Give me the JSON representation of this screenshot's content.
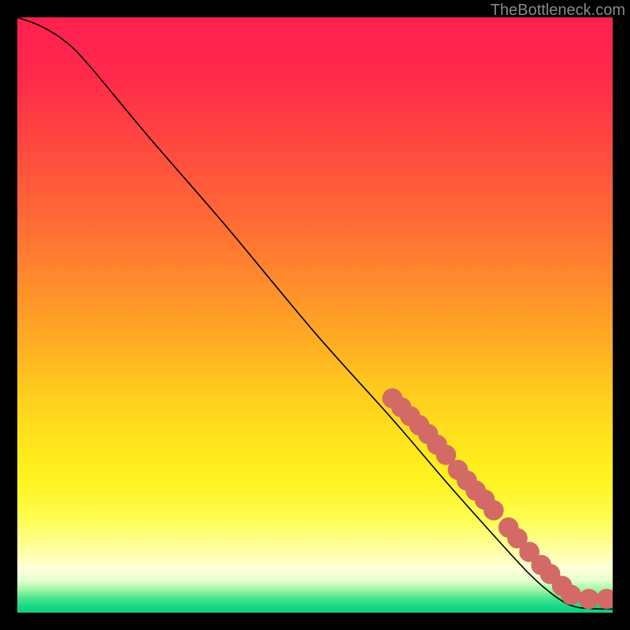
{
  "watermark": "TheBottleneck.com",
  "colors": {
    "marker": "#d36a66",
    "curve": "#000000"
  },
  "chart_data": {
    "type": "line",
    "title": "",
    "xlabel": "",
    "ylabel": "",
    "xlim": [
      0,
      100
    ],
    "ylim": [
      0,
      100
    ],
    "grid": false,
    "legend": false,
    "curve": [
      {
        "x": 0,
        "y": 100
      },
      {
        "x": 4,
        "y": 98.5
      },
      {
        "x": 8,
        "y": 96
      },
      {
        "x": 12,
        "y": 92
      },
      {
        "x": 22,
        "y": 80
      },
      {
        "x": 35,
        "y": 65
      },
      {
        "x": 50,
        "y": 47
      },
      {
        "x": 63,
        "y": 32.5
      },
      {
        "x": 72,
        "y": 22
      },
      {
        "x": 80,
        "y": 13
      },
      {
        "x": 86,
        "y": 6.5
      },
      {
        "x": 90,
        "y": 3
      },
      {
        "x": 93,
        "y": 1.2
      },
      {
        "x": 96,
        "y": 0.7
      },
      {
        "x": 100,
        "y": 0.6
      }
    ],
    "markers": {
      "radius_pct": 1.2,
      "points": [
        {
          "x": 63.0,
          "y": 36.0
        },
        {
          "x": 64.5,
          "y": 34.5
        },
        {
          "x": 66.0,
          "y": 33.0
        },
        {
          "x": 67.5,
          "y": 31.5
        },
        {
          "x": 69.0,
          "y": 30.0
        },
        {
          "x": 70.5,
          "y": 28.2
        },
        {
          "x": 72.0,
          "y": 26.5
        },
        {
          "x": 74.0,
          "y": 24.0
        },
        {
          "x": 75.5,
          "y": 22.2
        },
        {
          "x": 77.0,
          "y": 20.5
        },
        {
          "x": 78.5,
          "y": 19.0
        },
        {
          "x": 80.0,
          "y": 17.2
        },
        {
          "x": 82.5,
          "y": 14.3
        },
        {
          "x": 84.0,
          "y": 12.5
        },
        {
          "x": 86.0,
          "y": 10.2
        },
        {
          "x": 88.0,
          "y": 8.0
        },
        {
          "x": 89.5,
          "y": 6.5
        },
        {
          "x": 91.5,
          "y": 4.5
        },
        {
          "x": 93.0,
          "y": 3.0
        },
        {
          "x": 96.0,
          "y": 2.3
        },
        {
          "x": 99.0,
          "y": 2.3
        }
      ]
    }
  }
}
